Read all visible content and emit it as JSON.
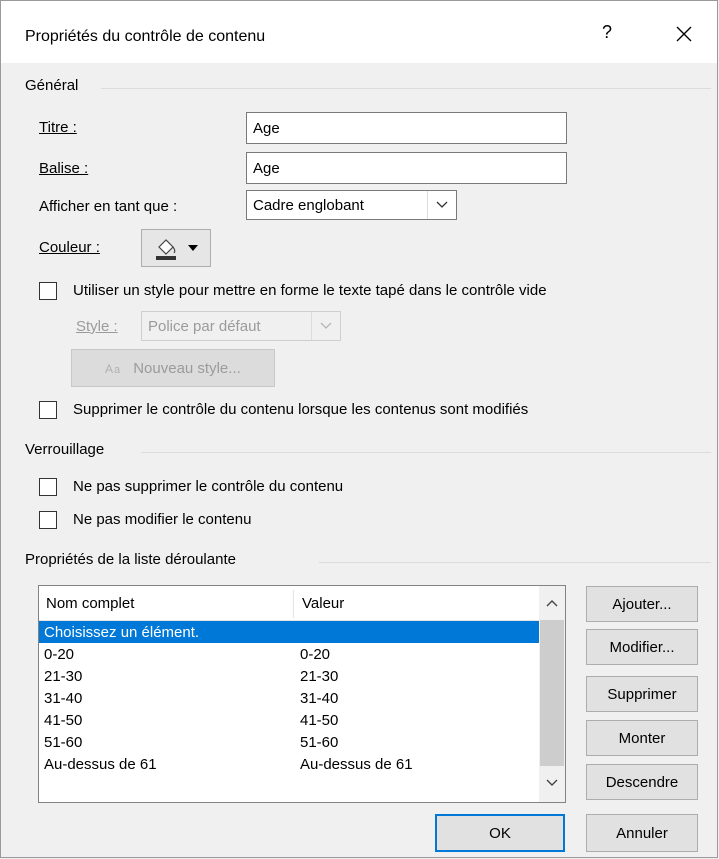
{
  "dialog": {
    "title": "Propriétés du contrôle de contenu",
    "help_label": "?"
  },
  "general": {
    "group_label": "Général",
    "title_label": "Titre :",
    "title_value": "Age",
    "tag_label": "Balise :",
    "tag_value": "Age",
    "display_label": "Afficher en tant que :",
    "display_value": "Cadre englobant",
    "color_label": "Couleur :",
    "use_style_label": "Utiliser un style pour mettre en forme le texte tapé dans le contrôle vide",
    "use_style_checked": false,
    "style_label": "Style :",
    "style_value": "Police par défaut",
    "new_style_label": "Nouveau style...",
    "remove_control_label": "Supprimer le contrôle du contenu lorsque les contenus sont modifiés",
    "remove_control_checked": false
  },
  "locking": {
    "group_label": "Verrouillage",
    "no_delete_label": "Ne pas supprimer le contrôle du contenu",
    "no_delete_checked": false,
    "no_edit_label": "Ne pas modifier le contenu",
    "no_edit_checked": false
  },
  "dropdown": {
    "group_label": "Propriétés de la liste déroulante",
    "columns": [
      "Nom complet",
      "Valeur"
    ],
    "rows": [
      {
        "name": "Choisissez un élément.",
        "value": "",
        "selected": true
      },
      {
        "name": "0-20",
        "value": "0-20"
      },
      {
        "name": "21-30",
        "value": "21-30"
      },
      {
        "name": "31-40",
        "value": "31-40"
      },
      {
        "name": "41-50",
        "value": "41-50"
      },
      {
        "name": "51-60",
        "value": "51-60"
      },
      {
        "name": "Au-dessus de 61",
        "value": "Au-dessus de 61"
      }
    ],
    "buttons": {
      "add": "Ajouter...",
      "modify": "Modifier...",
      "delete": "Supprimer",
      "up": "Monter",
      "down": "Descendre"
    }
  },
  "footer": {
    "ok": "OK",
    "cancel": "Annuler"
  },
  "colors": {
    "accent": "#0078d7",
    "color_swatch": "#333333"
  }
}
